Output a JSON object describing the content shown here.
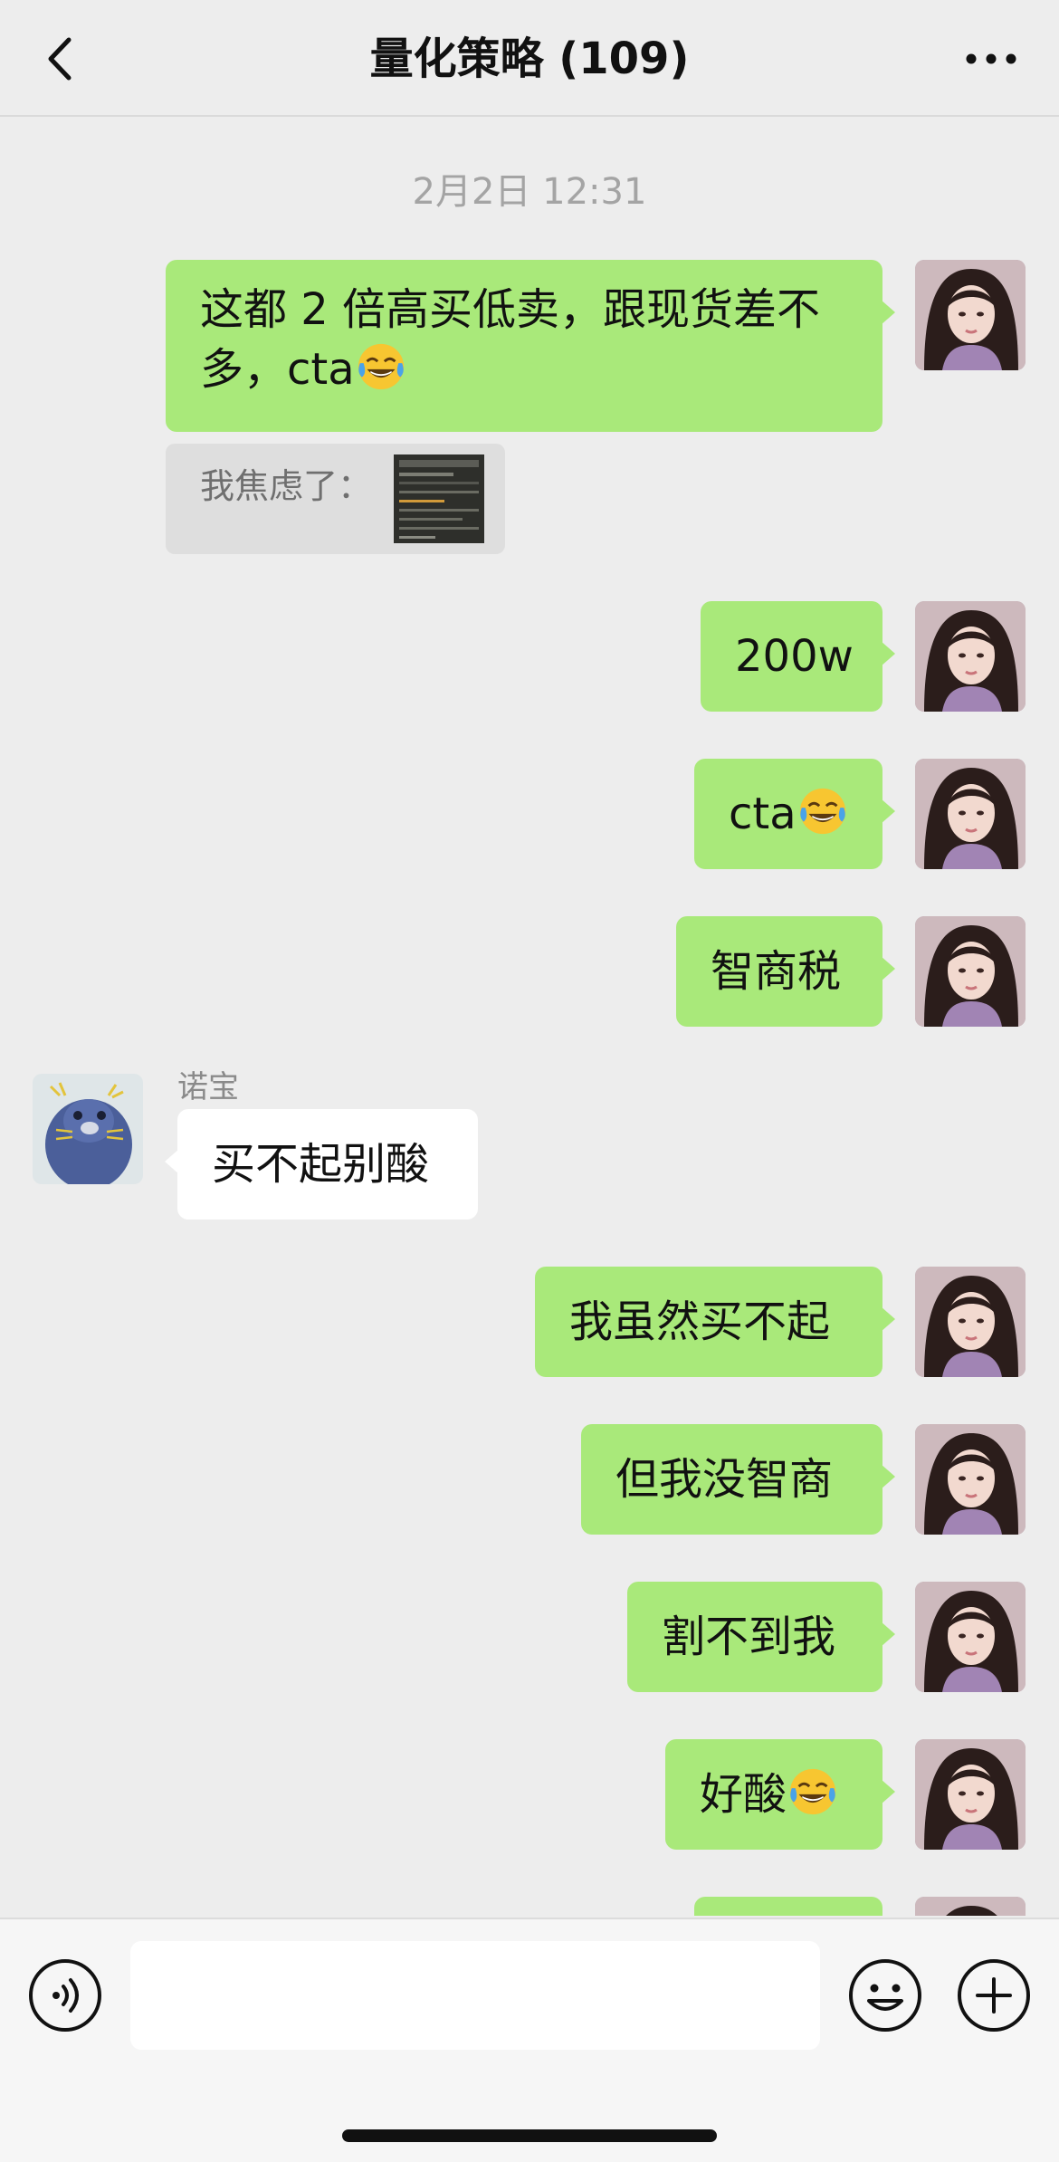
{
  "header": {
    "title": "量化策略 (109)"
  },
  "chat": {
    "timestamp": "2月2日 12:31",
    "quote_text": "我焦虑了：",
    "messages": [
      {
        "side": "right",
        "text": "这都 2 倍高买低卖，跟现货差不多，cta",
        "emoji": "tears-of-joy"
      },
      {
        "side": "right",
        "text": "200w"
      },
      {
        "side": "right",
        "text": "cta",
        "emoji": "tears-of-joy"
      },
      {
        "side": "right",
        "text": "智商税"
      },
      {
        "side": "left",
        "sender": "诺宝",
        "text": "买不起别酸"
      },
      {
        "side": "right",
        "text": "我虽然买不起"
      },
      {
        "side": "right",
        "text": "但我没智商"
      },
      {
        "side": "right",
        "text": "割不到我"
      },
      {
        "side": "right",
        "text": "好酸",
        "emoji": "tears-of-joy"
      }
    ]
  },
  "input": {
    "placeholder": "",
    "value": ""
  },
  "icons": {
    "back": "chevron-left-icon",
    "more": "more-dots-icon",
    "voice": "voice-icon",
    "emoji": "smiley-icon",
    "plus": "plus-icon"
  },
  "colors": {
    "my_bubble": "#a9e97a",
    "other_bubble": "#ffffff",
    "background": "#ededed"
  }
}
